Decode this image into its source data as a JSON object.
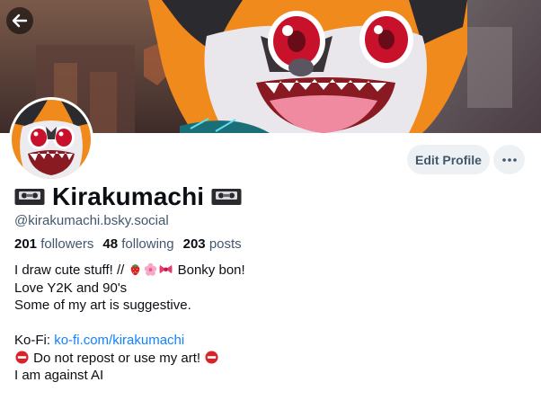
{
  "banner": {
    "back_button_label": "Back",
    "back_icon": "arrow-left-icon"
  },
  "profile": {
    "display_name": "Kirakumachi",
    "name_emoji": "videocassette-icon",
    "handle": "@kirakumachi.bsky.social",
    "avatar_icon": "avatar-character"
  },
  "actions": {
    "edit_profile_label": "Edit Profile",
    "more_icon": "ellipsis-icon"
  },
  "stats": {
    "followers_count": "201",
    "followers_label": "followers",
    "following_count": "48",
    "following_label": "following",
    "posts_count": "203",
    "posts_label": "posts"
  },
  "bio": {
    "line1_text": "I draw cute stuff! // ",
    "line1_emojis": [
      "strawberry-icon",
      "cherry-blossom-icon",
      "ribbon-icon"
    ],
    "line1_tail": " Bonky bon!",
    "line2": "Love Y2K and 90's",
    "line3": "Some of my art is suggestive.",
    "kofi_prefix": "Ko-Fi: ",
    "kofi_link": "ko-fi.com/kirakumachi",
    "norepost_text": " Do not repost or use my art! ",
    "norepost_icon": "no-entry-icon",
    "line_last": "I am against AI"
  },
  "colors": {
    "link": "#1083fe",
    "muted_text": "#42576c",
    "button_bg": "#eef1f4",
    "banner_orange": "#f08a1c"
  }
}
